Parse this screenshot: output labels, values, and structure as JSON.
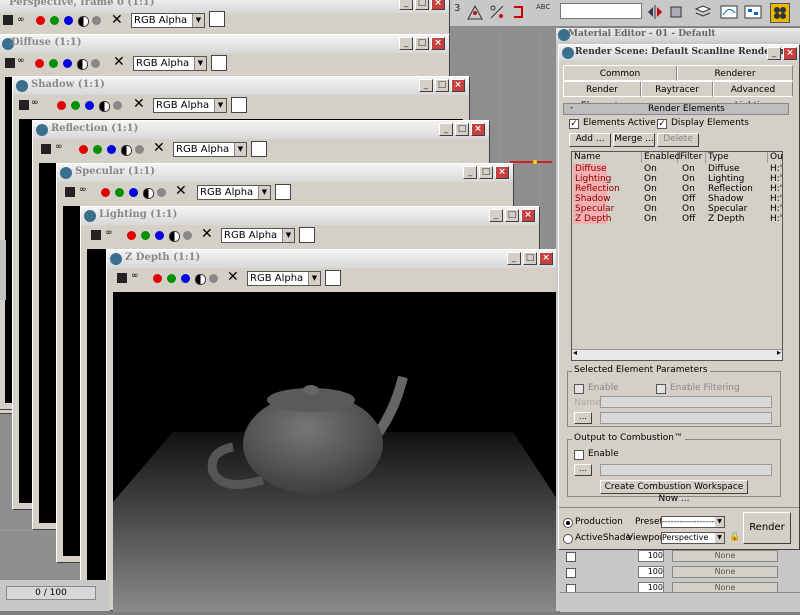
{
  "frame_windows": [
    {
      "title": "Perspective, frame 0 (1:1)",
      "channel": "RGB Alpha"
    },
    {
      "title": "Diffuse (1:1)",
      "channel": "RGB Alpha"
    },
    {
      "title": "Shadow (1:1)",
      "channel": "RGB Alpha"
    },
    {
      "title": "Reflection (1:1)",
      "channel": "RGB Alpha"
    },
    {
      "title": "Specular (1:1)",
      "channel": "RGB Alpha"
    },
    {
      "title": "Lighting (1:1)",
      "channel": "RGB Alpha"
    },
    {
      "title": "Z Depth (1:1)",
      "channel": "RGB Alpha"
    }
  ],
  "timeline": {
    "label": "0 / 100"
  },
  "material_editor": {
    "title": "Material Editor - 01 - Default"
  },
  "render_scene": {
    "title": "Render Scene: Default Scanline Renderer",
    "tabs_row1": [
      "Common",
      "Renderer"
    ],
    "tabs_row2": [
      "Render Elements",
      "Raytracer",
      "Advanced Lighting"
    ],
    "rollout_title": "Render Elements",
    "elements_active_label": "Elements Active",
    "display_elements_label": "Display Elements",
    "add_button": "Add ...",
    "merge_button": "Merge ...",
    "delete_button": "Delete",
    "columns": [
      "Name",
      "Enabled",
      "Filter",
      "Type",
      "Ou"
    ],
    "rows": [
      {
        "name": "Diffuse",
        "enabled": "On",
        "filter": "On",
        "type": "Diffuse",
        "out": "H:'"
      },
      {
        "name": "Lighting",
        "enabled": "On",
        "filter": "On",
        "type": "Lighting",
        "out": "H:'"
      },
      {
        "name": "Reflection",
        "enabled": "On",
        "filter": "On",
        "type": "Reflection",
        "out": "H:'"
      },
      {
        "name": "Shadow",
        "enabled": "On",
        "filter": "Off",
        "type": "Shadow",
        "out": "H:'"
      },
      {
        "name": "Specular",
        "enabled": "On",
        "filter": "On",
        "type": "Specular",
        "out": "H:'"
      },
      {
        "name": "Z Depth",
        "enabled": "On",
        "filter": "Off",
        "type": "Z Depth",
        "out": "H:'"
      }
    ],
    "selected_params_title": "Selected Element Parameters",
    "enable_label": "Enable",
    "enable_filtering_label": "Enable Filtering",
    "name_label": "Name:",
    "combustion_title": "Output to Combustion™",
    "combustion_enable_label": "Enable",
    "create_workspace_button": "Create Combustion Workspace Now ...",
    "production_label": "Production",
    "activeshade_label": "ActiveShade",
    "preset_label": "Preset:",
    "preset_value": "--------------------",
    "viewport_label": "Viewport:",
    "viewport_value": "Perspective",
    "render_button": "Render"
  },
  "material_rows": [
    {
      "value": "100",
      "map": "None"
    },
    {
      "value": "100",
      "map": "None"
    },
    {
      "value": "100",
      "map": "None"
    }
  ],
  "colors": {
    "red": "#e00000",
    "green": "#009000",
    "blue": "#0000e0",
    "highlight": "#f4b0b0"
  }
}
